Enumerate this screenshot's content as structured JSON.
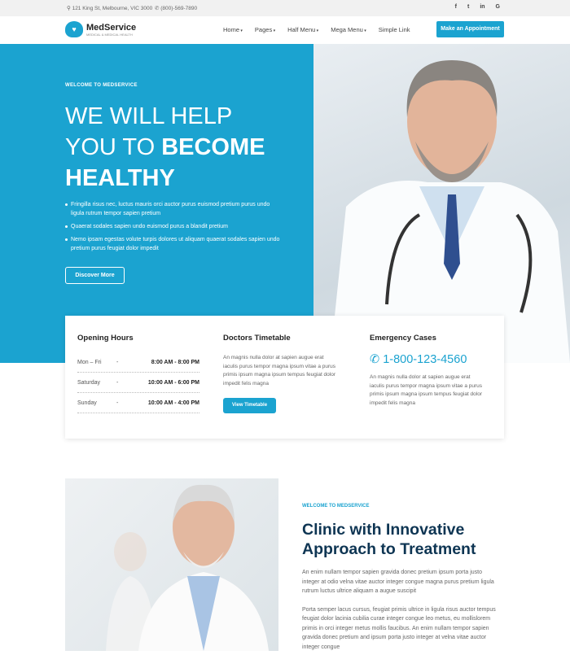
{
  "topbar": {
    "address": "121 King St, Melbourne, VIC 3000",
    "phone": "(800)-569-7890",
    "social": [
      "f",
      "t",
      "in",
      "G"
    ]
  },
  "nav": {
    "brand": "MedService",
    "tagline": "MEDICAL & MEDICAL HEALTH",
    "items": [
      "Home",
      "Pages",
      "Half Menu",
      "Mega Menu",
      "Simple Link"
    ],
    "cta": "Make an Appointment"
  },
  "hero": {
    "eyebrow": "WELCOME TO MEDSERVICE",
    "title_1": "WE WILL HELP",
    "title_2": "YOU TO ",
    "title_bold": "BECOME",
    "title_3": "HEALTHY",
    "bullets": [
      "Fringilla risus nec, luctus mauris orci auctor purus euismod pretium purus undo ligula rutrum tempor sapien pretium",
      "Quaerat sodales sapien undo euismod purus a blandit pretium",
      "Nemo ipsam egestas volute turpis dolores ut aliquam quaerat sodales sapien undo pretium purus feugiat dolor impedit"
    ],
    "button": "Discover More"
  },
  "info": {
    "hours": {
      "title": "Opening Hours",
      "rows": [
        {
          "day": "Mon – Fri",
          "sep": "-",
          "time": "8:00 AM - 8:00 PM"
        },
        {
          "day": "Saturday",
          "sep": "-",
          "time": "10:00 AM - 6:00 PM"
        },
        {
          "day": "Sunday",
          "sep": "-",
          "time": "10:00 AM - 4:00 PM"
        }
      ]
    },
    "timetable": {
      "title": "Doctors Timetable",
      "text": "An magnis nulla dolor at sapien augue erat iaculis purus tempor magna ipsum vitae a purus primis ipsum magna ipsum tempus feugiat dolor impedit felis magna",
      "button": "View Timetable"
    },
    "emergency": {
      "title": "Emergency Cases",
      "phone": "1-800-123-4560",
      "text": "An magnis nulla dolor at sapien augue erat iaculis purus tempor magna ipsum vitae a purus primis ipsum magna ipsum tempus feugiat dolor impedit felis magna"
    }
  },
  "about": {
    "eyebrow": "WELCOME TO MEDSERVICE",
    "title": "Clinic with Innovative Approach to Treatment",
    "p1": "An enim nullam tempor sapien gravida donec pretium ipsum porta justo integer at odio velna vitae auctor integer congue magna purus pretium ligula rutrum luctus ultrice aliquam a augue suscipit",
    "p2": "Porta semper lacus cursus, feugiat primis ultrice in ligula risus auctor tempus feugiat dolor lacinia cubilia curae integer congue leo metus, eu mollislorem primis in orci integer metus mollis faucibus. An enim nullam tempor sapien gravida donec pretium and ipsum porta justo integer at velna vitae auctor integer congue"
  }
}
